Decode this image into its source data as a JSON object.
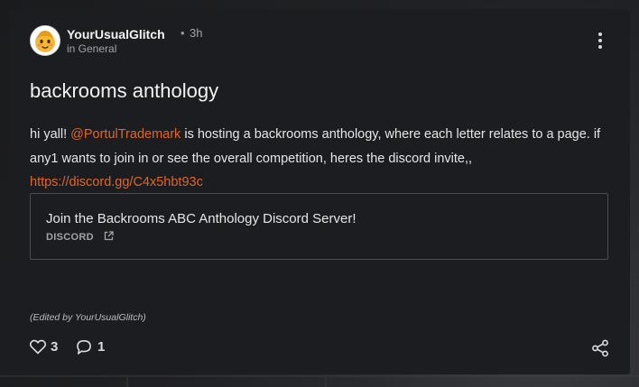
{
  "post": {
    "author": "YourUsualGlitch",
    "separator": "•",
    "time": "3h",
    "category": "in General",
    "title": "backrooms anthology",
    "body": {
      "intro": " hi yall! ",
      "mention": "@PortulTrademark",
      "text": " is hosting a backrooms anthology, where each letter relates to a page. if any1 wants to join in or see the overall competition, heres the discord invite,,",
      "link": "https://discord.gg/C4x5hbt93c"
    },
    "embed": {
      "title": "Join the Backrooms ABC Anthology Discord Server!",
      "source": "DISCORD"
    },
    "edited_note": "(Edited by YourUsualGlitch)",
    "likes": "3",
    "comments": "1"
  },
  "colors": {
    "accent": "#e0652a",
    "card_bg": "#1c1d20",
    "text": "#e6e6e6",
    "muted": "#a3a3a3"
  },
  "icons": {
    "avatar": "emoji-face-avatar",
    "menu": "kebab-menu-icon",
    "external": "external-link-icon",
    "like": "heart-icon",
    "comment": "comment-icon",
    "share": "share-icon"
  }
}
